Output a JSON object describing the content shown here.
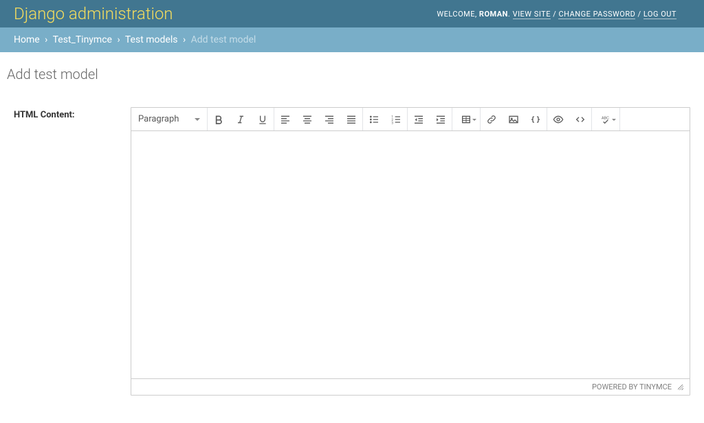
{
  "header": {
    "branding": "Django administration",
    "welcome_prefix": "WELCOME, ",
    "username": "ROMAN",
    "dot": ". ",
    "view_site": "VIEW SITE",
    "slash": " / ",
    "change_password": "CHANGE PASSWORD",
    "log_out": "LOG OUT"
  },
  "breadcrumbs": {
    "home": "Home",
    "sep": "›",
    "app": "Test_Tinymce",
    "model": "Test models",
    "current": "Add test model"
  },
  "page_title": "Add test model",
  "form": {
    "html_content_label": "HTML Content:"
  },
  "editor": {
    "format_label": "Paragraph",
    "status": "POWERED BY TINYMCE"
  }
}
